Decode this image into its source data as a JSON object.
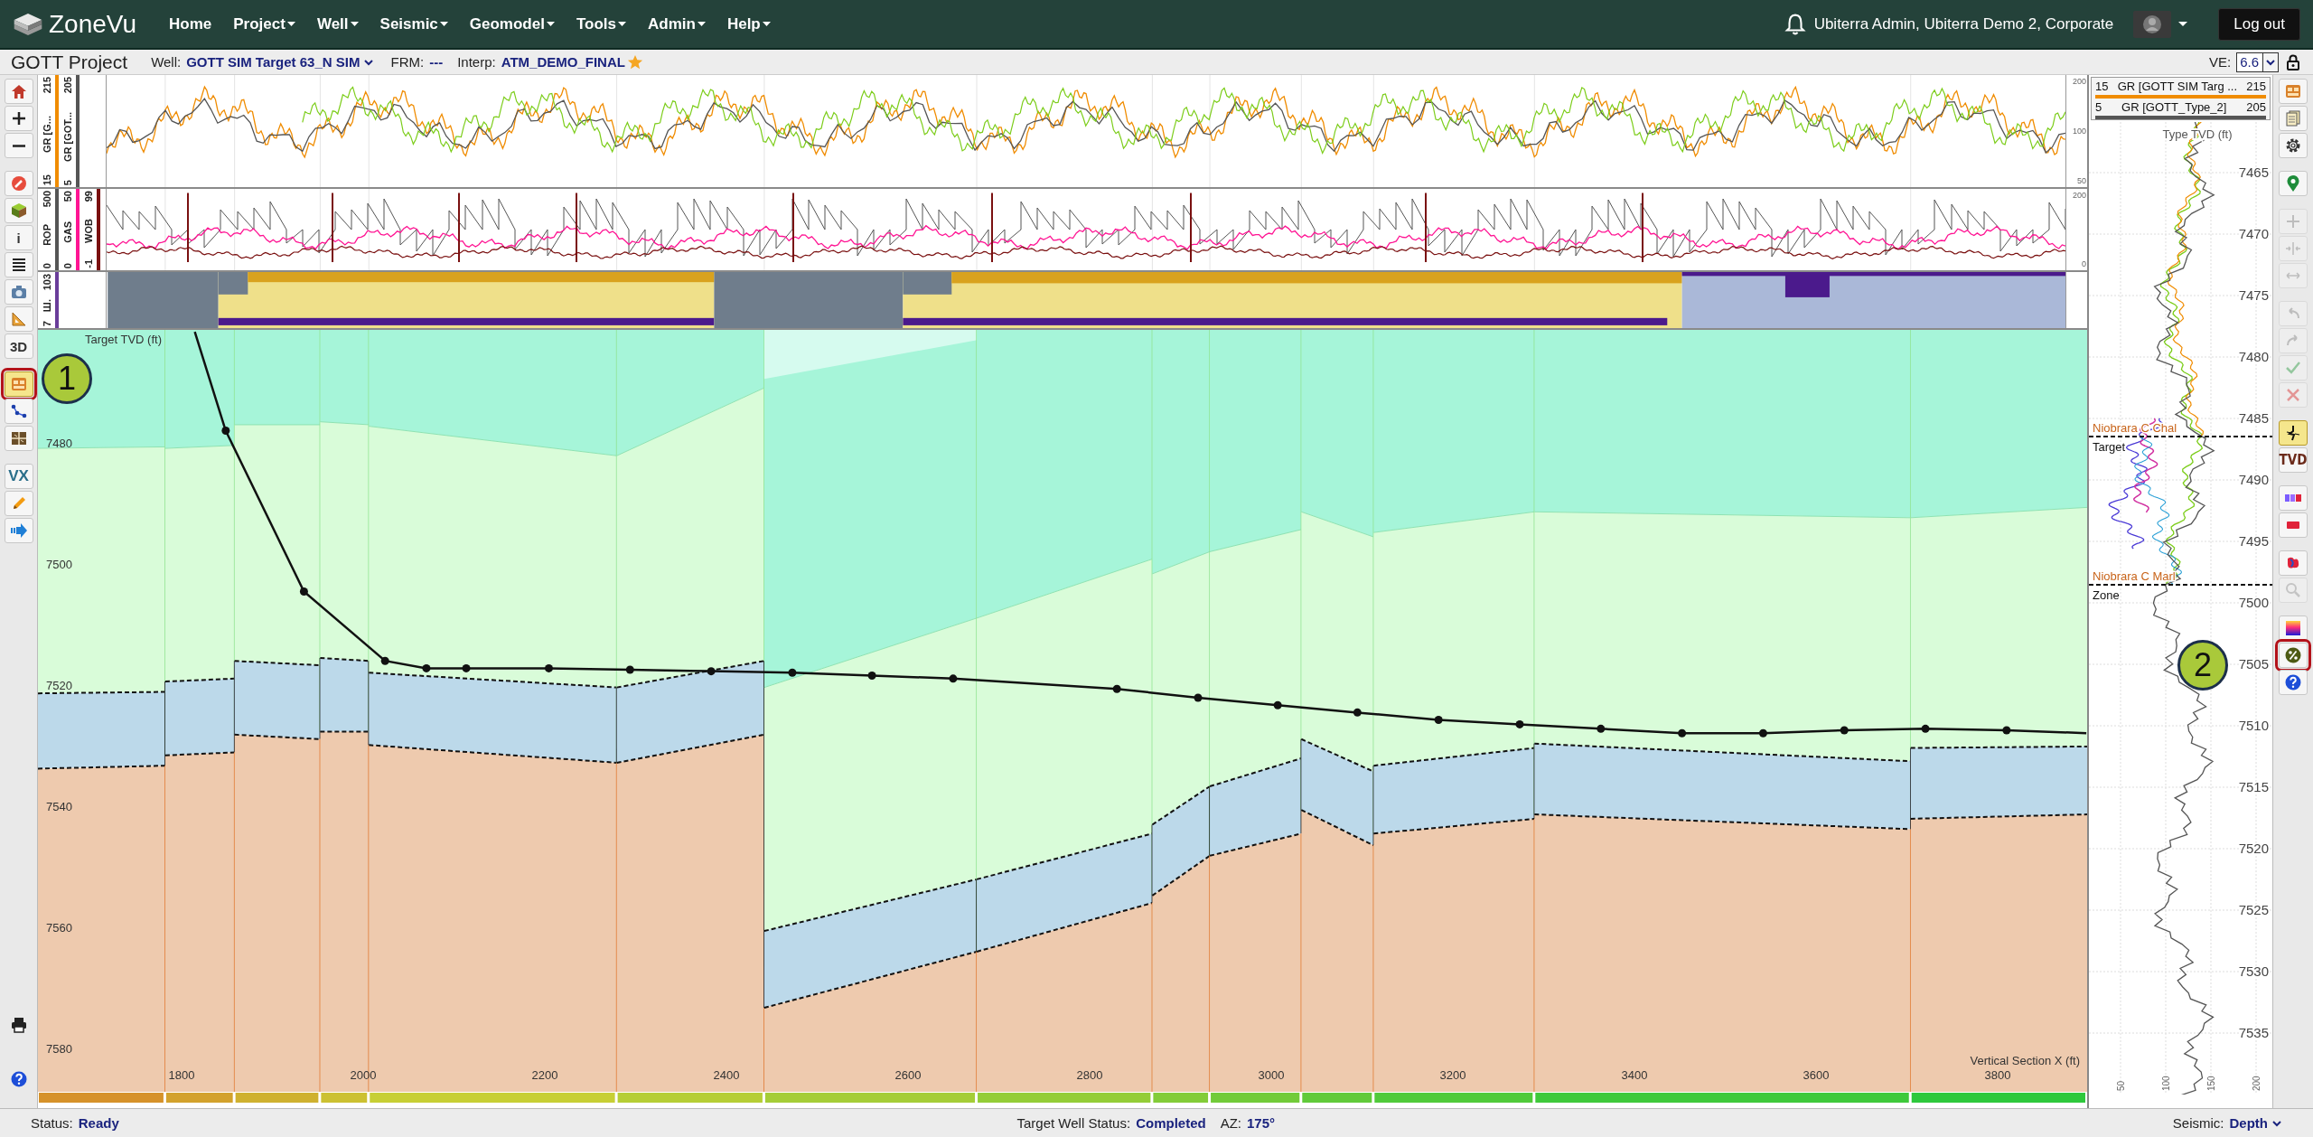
{
  "header": {
    "logo": "ZoneVu",
    "menu": [
      {
        "label": "Home",
        "dropdown": false
      },
      {
        "label": "Project",
        "dropdown": true
      },
      {
        "label": "Well",
        "dropdown": true
      },
      {
        "label": "Seismic",
        "dropdown": true
      },
      {
        "label": "Geomodel",
        "dropdown": true
      },
      {
        "label": "Tools",
        "dropdown": true
      },
      {
        "label": "Admin",
        "dropdown": true
      },
      {
        "label": "Help",
        "dropdown": true
      }
    ],
    "user": "Ubiterra Admin, Ubiterra Demo 2, Corporate",
    "logout": "Log out"
  },
  "project_bar": {
    "title": "GOTT Project",
    "well_label": "Well:",
    "well": "GOTT SIM Target 63_N SIM",
    "frm_label": "FRM:",
    "frm": "---",
    "interp_label": "Interp:",
    "interp": "ATM_DEMO_FINAL",
    "favorite": true,
    "ve_label": "VE:",
    "ve": "6.6"
  },
  "left_toolbar": [
    {
      "kind": "icon",
      "selected": false,
      "highlighted": false
    },
    {
      "kind": "icon",
      "selected": false,
      "highlighted": false
    },
    {
      "kind": "icon",
      "selected": false,
      "highlighted": false
    },
    {
      "kind": "icon",
      "selected": false,
      "highlighted": false
    },
    {
      "kind": "icon",
      "selected": false,
      "highlighted": false
    },
    {
      "kind": "text",
      "label": "i",
      "selected": false,
      "highlighted": false
    },
    {
      "kind": "icon",
      "selected": false,
      "highlighted": false
    },
    {
      "kind": "icon",
      "selected": false,
      "highlighted": false
    },
    {
      "kind": "icon",
      "selected": false,
      "highlighted": false
    },
    {
      "kind": "text",
      "label": "3D",
      "selected": false,
      "highlighted": false
    },
    {
      "kind": "icon",
      "selected": true,
      "highlighted": true
    },
    {
      "kind": "icon",
      "selected": false,
      "highlighted": false
    },
    {
      "kind": "icon",
      "selected": false,
      "highlighted": false
    },
    {
      "kind": "text",
      "label": "VX",
      "selected": false,
      "highlighted": false
    },
    {
      "kind": "icon",
      "selected": false,
      "highlighted": false
    },
    {
      "kind": "icon",
      "selected": false,
      "highlighted": false
    }
  ],
  "left_toolbar_bottom": [
    {
      "kind": "icon"
    },
    {
      "kind": "icon"
    }
  ],
  "log_tracks": [
    {
      "curves": [
        {
          "name": "GR [G...",
          "min": "15",
          "max": "215",
          "color": "#f08c00"
        },
        {
          "name": "GR [GOT...",
          "min": "5",
          "max": "205",
          "color": "#555555"
        }
      ],
      "scale": [
        "200",
        "100",
        "50"
      ]
    },
    {
      "curves": [
        {
          "name": "ROP",
          "min": "0",
          "max": "500",
          "color": "#555555"
        },
        {
          "name": "GAS",
          "min": "0",
          "max": "50",
          "color": "#ff1493"
        },
        {
          "name": "WOB",
          "min": "-1",
          "max": "99",
          "color": "#7a1010"
        }
      ],
      "scale": [
        "200",
        "0"
      ]
    },
    {
      "curves": [
        {
          "name": "Ш.",
          "min": "7",
          "max": "103",
          "color": "#6a3d9a"
        }
      ]
    }
  ],
  "section": {
    "y_title": "Target TVD (ft)",
    "y_ticks": [
      "7480",
      "7500",
      "7520",
      "7540",
      "7560",
      "7580"
    ],
    "x_title": "Vertical Section X (ft)",
    "x_ticks": [
      "1800",
      "2000",
      "2200",
      "2400",
      "2600",
      "2800",
      "3000",
      "3200",
      "3400",
      "3600",
      "3800"
    ]
  },
  "type_log": {
    "curves": [
      {
        "min": "15",
        "name": "GR [GOTT SIM Targ ...",
        "max": "215",
        "color": "#f08c00"
      },
      {
        "min": "5",
        "name": "GR [GOTT_Type_2]",
        "max": "205",
        "color": "#555555"
      }
    ],
    "title": "Type TVD (ft)",
    "depth_ticks": [
      "7465",
      "7470",
      "7475",
      "7480",
      "7485",
      "7490",
      "7495",
      "7500",
      "7505",
      "7510",
      "7515",
      "7520",
      "7525",
      "7530",
      "7535"
    ],
    "x_ticks": [
      "50",
      "100",
      "150",
      "200"
    ],
    "markers": [
      {
        "name": "Niobrara C Chal",
        "zone": "Target"
      },
      {
        "name": "Niobrara C Marl",
        "zone": "Zone"
      }
    ]
  },
  "right_toolbar": [
    {
      "kind": "icon",
      "selected": false,
      "disabled": false,
      "highlighted": false
    },
    {
      "kind": "icon",
      "selected": false,
      "disabled": false,
      "highlighted": false
    },
    {
      "kind": "icon",
      "selected": false,
      "disabled": false,
      "highlighted": false
    },
    {
      "kind": "icon",
      "selected": false,
      "disabled": false,
      "highlighted": false
    },
    {
      "kind": "icon",
      "selected": false,
      "disabled": true,
      "highlighted": false
    },
    {
      "kind": "icon",
      "selected": false,
      "disabled": true,
      "highlighted": false
    },
    {
      "kind": "icon",
      "selected": false,
      "disabled": true,
      "highlighted": false
    },
    {
      "kind": "icon",
      "selected": false,
      "disabled": true,
      "highlighted": false
    },
    {
      "kind": "icon",
      "selected": false,
      "disabled": true,
      "highlighted": false
    },
    {
      "kind": "icon",
      "selected": false,
      "disabled": true,
      "highlighted": false
    },
    {
      "kind": "icon",
      "selected": false,
      "disabled": true,
      "highlighted": false
    },
    {
      "kind": "icon",
      "selected": true,
      "disabled": false,
      "highlighted": false
    },
    {
      "kind": "text",
      "label": "TVD",
      "selected": false,
      "disabled": false,
      "highlighted": false
    },
    {
      "kind": "icon",
      "selected": false,
      "disabled": false,
      "highlighted": false
    },
    {
      "kind": "icon",
      "selected": false,
      "disabled": false,
      "highlighted": false
    },
    {
      "kind": "icon",
      "selected": false,
      "disabled": false,
      "highlighted": false
    },
    {
      "kind": "icon",
      "selected": false,
      "disabled": true,
      "highlighted": false
    },
    {
      "kind": "icon",
      "selected": false,
      "disabled": false,
      "highlighted": false
    },
    {
      "kind": "icon",
      "selected": false,
      "disabled": false,
      "highlighted": true
    },
    {
      "kind": "icon",
      "selected": false,
      "disabled": false,
      "highlighted": false
    }
  ],
  "callouts": [
    {
      "label": "1"
    },
    {
      "label": "2"
    }
  ],
  "status_bar": {
    "status_label": "Status:",
    "status": "Ready",
    "well_status_label": "Target Well Status:",
    "well_status": "Completed",
    "az_label": "AZ:",
    "az": "175°",
    "seismic_label": "Seismic:",
    "seismic": "Depth"
  }
}
